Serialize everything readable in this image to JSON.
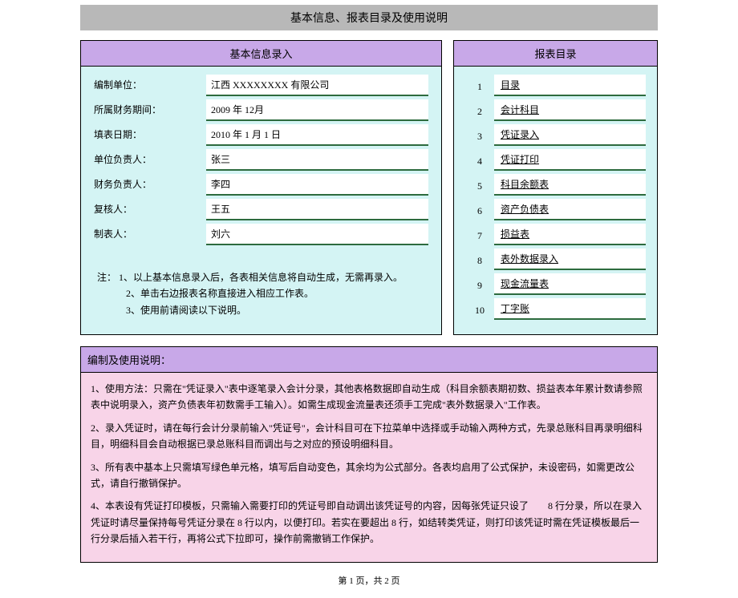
{
  "title": "基本信息、报表目录及使用说明",
  "leftPanel": {
    "header": "基本信息录入",
    "rows": [
      {
        "label": "编制单位：",
        "value": "江西 XXXXXXXX 有限公司"
      },
      {
        "label": "所属财务期间：",
        "value": "2009 年 12月"
      },
      {
        "label": "填表日期：",
        "value": "2010 年 1 月 1 日"
      },
      {
        "label": "单位负责人：",
        "value": "张三"
      },
      {
        "label": "财务负责人：",
        "value": "李四"
      },
      {
        "label": "复核人：",
        "value": "王五"
      },
      {
        "label": "制表人：",
        "value": "刘六"
      }
    ],
    "notes": [
      "注： 1、以上基本信息录入后，各表相关信息将自动生成，无需再录入。",
      "2、单击右边报表名称直接进入相应工作表。",
      "3、使用前请阅读以下说明。"
    ]
  },
  "rightPanel": {
    "header": "报表目录",
    "items": [
      {
        "num": "1",
        "label": "目录"
      },
      {
        "num": "2",
        "label": "会计科目"
      },
      {
        "num": "3",
        "label": "凭证录入"
      },
      {
        "num": "4",
        "label": "凭证打印"
      },
      {
        "num": "5",
        "label": "科目余额表"
      },
      {
        "num": "6",
        "label": "资产负债表"
      },
      {
        "num": "7",
        "label": "损益表"
      },
      {
        "num": "8",
        "label": "表外数据录入"
      },
      {
        "num": "9",
        "label": "现金流量表"
      },
      {
        "num": "10",
        "label": "丁字账"
      }
    ]
  },
  "instructions": {
    "header": "编制及使用说明：",
    "paragraphs": [
      "1、使用方法：只需在\"凭证录入\"表中逐笔录入会计分录，其他表格数据即自动生成（科目余额表期初数、损益表本年累计数请参照表中说明录入，资产负债表年初数需手工输入）。如需生成现金流量表还须手工完成\"表外数据录入\"工作表。",
      "2、录入凭证时，请在每行会计分录前输入\"凭证号\"，会计科目可在下拉菜单中选择或手动输入两种方式，先录总账科目再录明细科目，明细科目会自动根据已录总账科目而调出与之对应的预设明细科目。",
      "3、所有表中基本上只需填写绿色单元格，填写后自动变色，其余均为公式部分。各表均启用了公式保护，未设密码，如需更改公式，请自行撤销保护。",
      "4、本表设有凭证打印模板，只需输入需要打印的凭证号即自动调出该凭证号的内容，因每张凭证只设了　　8 行分录，所以在录入凭证时请尽量保持每号凭证分录在 8 行以内，以便打印。若实在要超出 8 行，如结转类凭证，则打印该凭证时需在凭证模板最后一行分录后插入若干行，再将公式下拉即可，操作前需撤销工作保护。"
    ]
  },
  "footer": "第 1 页，共 2 页"
}
